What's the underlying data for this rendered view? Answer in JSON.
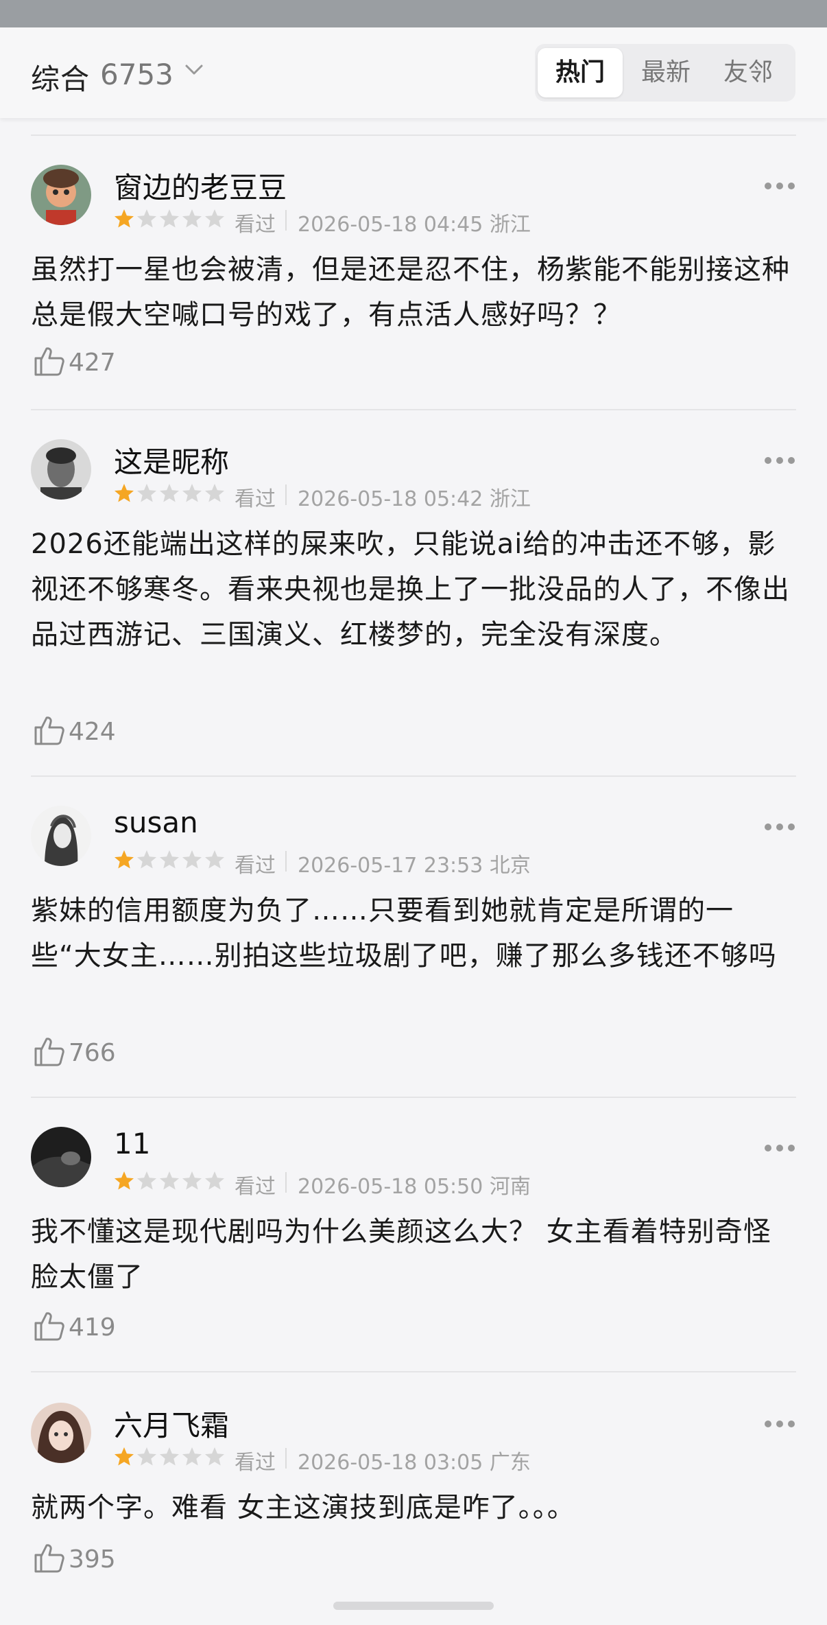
{
  "header": {
    "sort_label": "综合",
    "count": "6753",
    "tabs": [
      {
        "label": "热门",
        "active": true
      },
      {
        "label": "最新",
        "active": false
      },
      {
        "label": "友邻",
        "active": false
      }
    ]
  },
  "reviews": [
    {
      "name": "窗边的老豆豆",
      "rating": 1,
      "status": "看过",
      "datetime": "2026-05-18 04:45 浙江",
      "content": "虽然打一星也会被清，但是还是忍不住，杨紫能不能别接这种总是假大空喊口号的戏了，有点活人感好吗？？",
      "likes": "427"
    },
    {
      "name": "这是昵称",
      "rating": 1,
      "status": "看过",
      "datetime": "2026-05-18 05:42 浙江",
      "content": "2026还能端出这样的屎来吹，只能说ai给的冲击还不够，影视还不够寒冬。看来央视也是换上了一批没品的人了，不像出品过西游记、三国演义、红楼梦的，完全没有深度。",
      "likes": "424"
    },
    {
      "name": "susan",
      "rating": 1,
      "status": "看过",
      "datetime": "2026-05-17 23:53 北京",
      "content": "紫妹的信用额度为负了……只要看到她就肯定是所谓的一些“大女主……别拍这些垃圾剧了吧，赚了那么多钱还不够吗",
      "likes": "766"
    },
    {
      "name": "11",
      "rating": 1,
      "status": "看过",
      "datetime": "2026-05-18 05:50 河南",
      "content": "我不懂这是现代剧吗为什么美颜这么大？ 女主看着特别奇怪脸太僵了",
      "likes": "419"
    },
    {
      "name": "六月飞霜",
      "rating": 1,
      "status": "看过",
      "datetime": "2026-05-18 03:05 广东",
      "content": "就两个字。难看 女主这演技到底是咋了。。。",
      "likes": "395"
    }
  ],
  "colors": {
    "star_filled": "#f5a623",
    "star_empty": "#d6d6d6",
    "meta_text": "#a3a3a3",
    "active_tab_bg": "#ffffff"
  }
}
